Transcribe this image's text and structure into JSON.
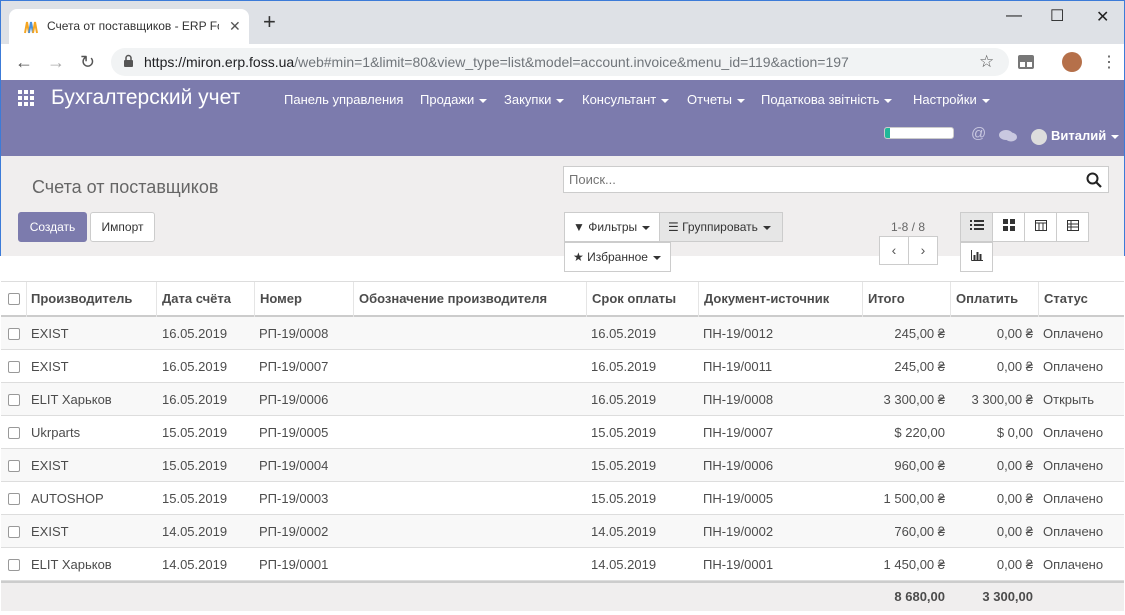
{
  "browser": {
    "tab_title": "Счета от поставщиков - ERP Fos",
    "new_tab": "+",
    "url_host": "https://miron.erp.foss.ua",
    "url_rest": "/web#min=1&limit=80&view_type=list&model=account.invoice&menu_id=119&action=197"
  },
  "nav": {
    "app_title": "Бухгалтерский учет",
    "menu": [
      "Панель управления",
      "Продажи",
      "Закупки",
      "Консультант",
      "Отчеты",
      "Податкова звітність",
      "Настройки"
    ],
    "user": "Виталий",
    "progress": 0.08
  },
  "control": {
    "breadcrumb": "Счета от поставщиков",
    "search_placeholder": "Поиск...",
    "create_label": "Создать",
    "import_label": "Импорт",
    "filters_label": "Фильтры",
    "group_label": "Группировать",
    "favorites_label": "Избранное",
    "pager": "1-8 / 8"
  },
  "table": {
    "headers": [
      "Производитель",
      "Дата счёта",
      "Номер",
      "Обозначение производителя",
      "Срок оплаты",
      "Документ-источник",
      "Итого",
      "Оплатить",
      "Статус"
    ],
    "rows": [
      [
        "EXIST",
        "16.05.2019",
        "РП-19/0008",
        "",
        "16.05.2019",
        "ПН-19/0012",
        "245,00 ₴",
        "0,00 ₴",
        "Оплачено"
      ],
      [
        "EXIST",
        "16.05.2019",
        "РП-19/0007",
        "",
        "16.05.2019",
        "ПН-19/0011",
        "245,00 ₴",
        "0,00 ₴",
        "Оплачено"
      ],
      [
        "ELIT Харьков",
        "16.05.2019",
        "РП-19/0006",
        "",
        "16.05.2019",
        "ПН-19/0008",
        "3 300,00 ₴",
        "3 300,00 ₴",
        "Открыть"
      ],
      [
        "Ukrparts",
        "15.05.2019",
        "РП-19/0005",
        "",
        "15.05.2019",
        "ПН-19/0007",
        "$ 220,00",
        "$ 0,00",
        "Оплачено"
      ],
      [
        "EXIST",
        "15.05.2019",
        "РП-19/0004",
        "",
        "15.05.2019",
        "ПН-19/0006",
        "960,00 ₴",
        "0,00 ₴",
        "Оплачено"
      ],
      [
        "AUTOSHOP",
        "15.05.2019",
        "РП-19/0003",
        "",
        "15.05.2019",
        "ПН-19/0005",
        "1 500,00 ₴",
        "0,00 ₴",
        "Оплачено"
      ],
      [
        "EXIST",
        "14.05.2019",
        "РП-19/0002",
        "",
        "14.05.2019",
        "ПН-19/0002",
        "760,00 ₴",
        "0,00 ₴",
        "Оплачено"
      ],
      [
        "ELIT Харьков",
        "14.05.2019",
        "РП-19/0001",
        "",
        "14.05.2019",
        "ПН-19/0001",
        "1 450,00 ₴",
        "0,00 ₴",
        "Оплачено"
      ]
    ],
    "total_sum": "8 680,00",
    "total_due": "3 300,00"
  },
  "colors": {
    "brand": "#7c7bad",
    "accent": "#21b799"
  }
}
